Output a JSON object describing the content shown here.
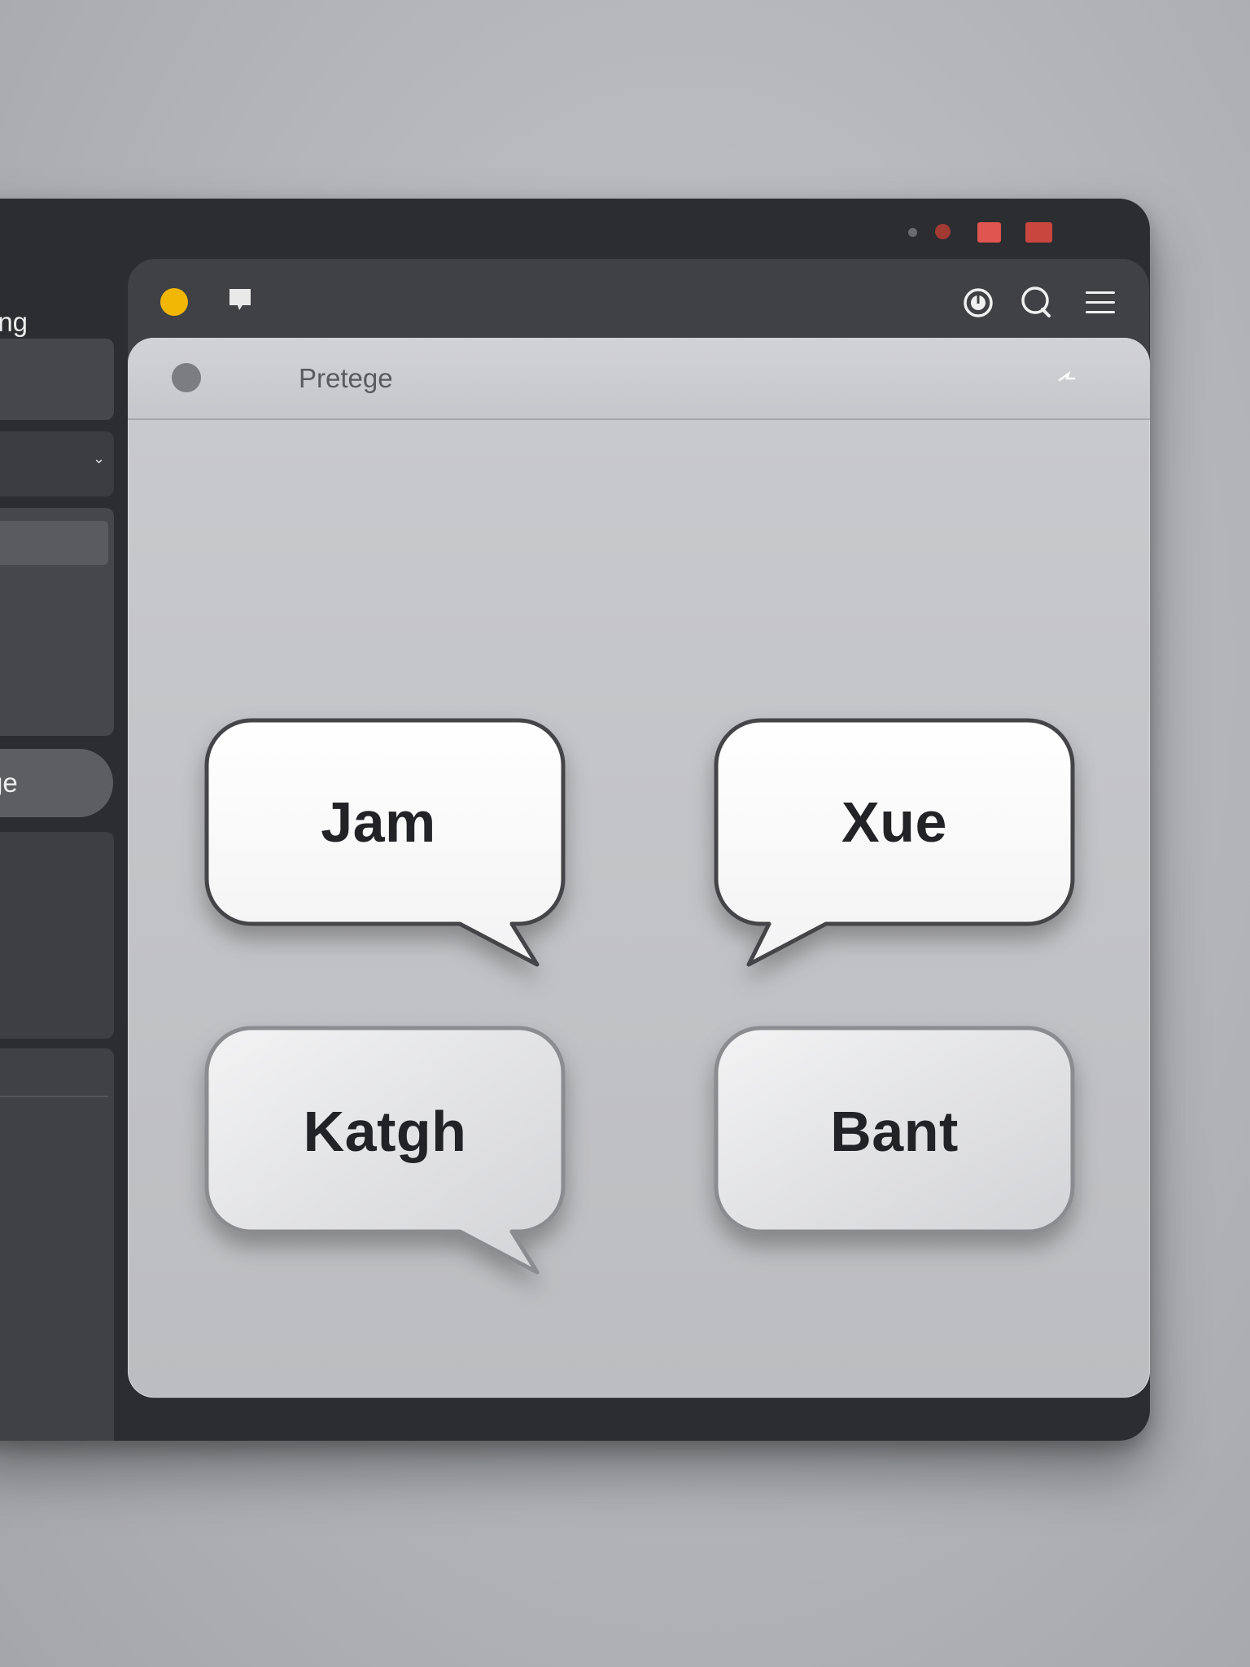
{
  "sidebar": {
    "title_partial": "ing",
    "selected_item_partial": "ge",
    "chevron": "⌄"
  },
  "toolbar": {
    "icons": [
      "yellow-status-dot",
      "note-icon",
      "clock-icon",
      "chat-icon",
      "menu-icon"
    ]
  },
  "content": {
    "title": "Pretege",
    "pin_icon": "pin-icon"
  },
  "bubbles": [
    {
      "label": "Jam",
      "style": "white",
      "tail": "bottom-right"
    },
    {
      "label": "Xue",
      "style": "white",
      "tail": "bottom-left"
    },
    {
      "label": "Katgh",
      "style": "gray",
      "tail": "bottom-right"
    },
    {
      "label": "Bant",
      "style": "gray",
      "tail": "none"
    }
  ],
  "colors": {
    "accent_yellow": "#f2b705",
    "window_red": "#e0554f",
    "window_dark": "#2c2d30"
  }
}
